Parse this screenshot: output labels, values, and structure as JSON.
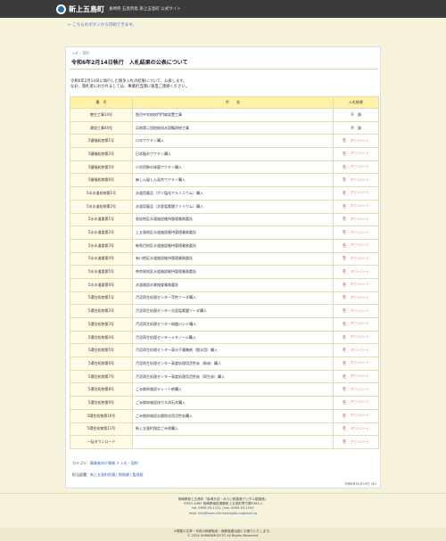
{
  "site": {
    "name": "新上五島町",
    "subtitle": "長崎県 五島列島 新上五島町 公式サイト",
    "print_link": "← こちらのボタンから印刷できます。"
  },
  "article": {
    "category_small": "入札・契約",
    "title": "令和6年2月14日執行　入札結果の公表について",
    "intro_line1": "令和6年2月14日に執行した競争入札の結果について、公表します。",
    "intro_line2": "なお、落札者におかれましては、事業担当課に速度ご連絡ください。"
  },
  "table": {
    "headers": [
      "番　号",
      "件　　名",
      "入札結果"
    ],
    "rows": [
      {
        "no": "教生工事14号",
        "name": "魚目中学校校門門扉設置工事",
        "result": "不　調"
      },
      {
        "no": "建設工事44号",
        "name": "浜串第二団地給排水設備改修工事",
        "result": "不　調"
      },
      {
        "no": "5健福処物第1号",
        "name": "ロタワクチン購入",
        "result": "PDF"
      },
      {
        "no": "5健福処物第2号",
        "name": "日本脳炎ワクチン購入",
        "result": "PDF"
      },
      {
        "no": "5健福処物第5号",
        "name": "小児用肺炎球菌ワクチン購入",
        "result": "PDF"
      },
      {
        "no": "5健福処物第6号",
        "name": "麻しん風しん混合ワクチン購入",
        "result": "PDF"
      },
      {
        "no": "5水水道処物第1号",
        "name": "水道用薬品（ポリ塩化アルミニウム）購入",
        "result": "PDF"
      },
      {
        "no": "5水水道処物第2号",
        "name": "水道用薬品（次亜塩素酸ナトリウム）購入",
        "result": "PDF"
      },
      {
        "no": "5水水道委第1号",
        "name": "若松地区水道施設維持管理業務委託",
        "result": "PDF"
      },
      {
        "no": "5水水道委第2号",
        "name": "上五島地区水道施設維持管理業務委託",
        "result": "PDF"
      },
      {
        "no": "5水水道委第3号",
        "name": "新魚目地区水道施設維持管理業務委託",
        "result": "PDF"
      },
      {
        "no": "5水水道委第4号",
        "name": "有川地区水道施設維持管理業務委託",
        "result": "PDF"
      },
      {
        "no": "5水水道委第5号",
        "name": "奈良尾地区水道施設維持管理業務委託",
        "result": "PDF"
      },
      {
        "no": "5水水道委第6号",
        "name": "水道施設水質検査業務委託",
        "result": "PDF"
      },
      {
        "no": "5環住処物第1号",
        "name": "汚泥再生処理センター苛性ソーダ購入",
        "result": "PDF"
      },
      {
        "no": "5環住処物第2号",
        "name": "汚泥再生処理センター次亜塩素酸ソーダ購入",
        "result": "PDF"
      },
      {
        "no": "5環住処物第3号",
        "name": "汚泥再生処理センター硫酸バンド購入",
        "result": "PDF"
      },
      {
        "no": "5環住処物第4号",
        "name": "汚泥再生処理センターメタノール購入",
        "result": "PDF"
      },
      {
        "no": "5環住処物第5号",
        "name": "汚泥再生処理センター高分子凝集剤（脱水用）購入",
        "result": "PDF"
      },
      {
        "no": "5環住処物第6号",
        "name": "汚泥再生処理センター高度処理用活性炭（新炭）購入",
        "result": "PDF"
      },
      {
        "no": "5環住処物第7号",
        "name": "汚泥再生処理センター高度処理用活性炭（再生炭）購入",
        "result": "PDF"
      },
      {
        "no": "5環住処物第8号",
        "name": "ごみ燃却施設キレート剤購入",
        "result": "PDF"
      },
      {
        "no": "5環住処物第9号",
        "name": "ごみ燃却施設排ガス消石灰購入",
        "result": "PDF"
      },
      {
        "no": "5環住処物第10号",
        "name": "ごみ燃却施設水銀除去用活性炭購入",
        "result": "PDF"
      },
      {
        "no": "5環住処物第11号",
        "name": "新上五島町指定ごみ袋購入",
        "result": "PDF"
      },
      {
        "no": "一括ダウンロード",
        "name": "",
        "result": "PDF"
      }
    ],
    "pdf_label": "ダウンロード"
  },
  "meta": {
    "category_label": "カテゴリ：",
    "category_1": "事業者向け情報",
    "category_sep": " > ",
    "category_2": "入札・契約",
    "dept_label": "担当部署：",
    "dept_value": "新上五島町役場 | 財務課 | 監理班",
    "updated": "令和6年02月15日 (木)"
  },
  "footer": {
    "line1": "長崎県新上五島町「盲導犬法・みらい航路港デジタル航路港」",
    "line2": "〒857-4495 長崎県南松浦郡新上五島町青方郷1585-1",
    "line3": "tel. 0959-53-1111 / fax. 0959-53-1100",
    "line4_label": "mail. ",
    "line4_email": "info@town.shinkamigoto.nagasaki.jp",
    "copy1": "※掲載の文章・写真の無断転用・無断転載は固くお断りいたします。",
    "copy2": "© 2024 SHINKAMIGOTO All Rights Reserved."
  },
  "colors": {
    "accent_link": "#2f66b3",
    "header_bg": "#3b3b3b",
    "table_header": "#fff1a8",
    "pdf_red": "#d32f2f"
  }
}
